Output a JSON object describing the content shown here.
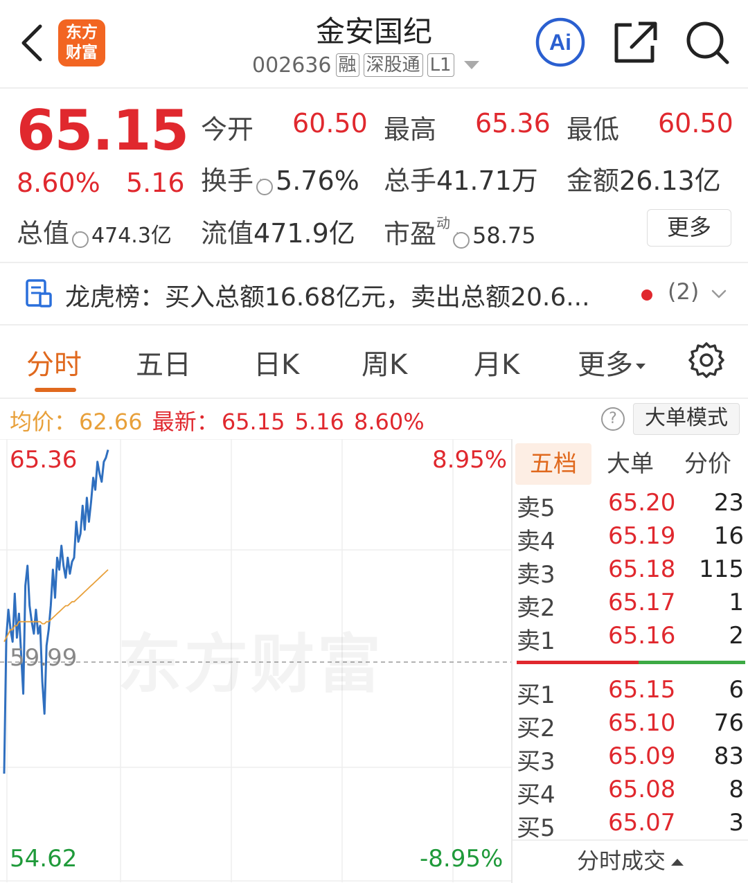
{
  "header": {
    "logo_line1": "东方",
    "logo_line2": "财富",
    "stock_name": "金安国纪",
    "stock_code": "002636",
    "tags": [
      "融",
      "深股通",
      "L1"
    ]
  },
  "quote": {
    "price": "65.15",
    "change_pct": "8.60%",
    "change_amt": "5.16",
    "open_label": "今开",
    "open": "60.50",
    "high_label": "最高",
    "high": "65.36",
    "low_label": "最低",
    "low": "60.50",
    "turnover_label": "换手",
    "turnover": "5.76%",
    "volume_label": "总手",
    "volume": "41.71万",
    "amount_label": "金额",
    "amount": "26.13亿",
    "mktcap_label": "总值",
    "mktcap": "474.3亿",
    "float_label": "流值",
    "float_cap": "471.9亿",
    "pe_label": "市盈",
    "pe_sup": "动",
    "pe": "58.75",
    "more_label": "更多"
  },
  "lhb": {
    "text": "龙虎榜：买入总额16.68亿元，卖出总额20.6...",
    "count": "(2)"
  },
  "tabs": {
    "fenshi": "分时",
    "wuri": "五日",
    "rik": "日K",
    "zhouk": "周K",
    "yuek": "月K",
    "more": "更多"
  },
  "avg_row": {
    "avg_label": "均价：",
    "avg_value": "62.66",
    "latest_label": "最新：",
    "latest_value": "65.15",
    "latest_change": "5.16",
    "latest_pct": "8.60%",
    "help": "?",
    "big_order_mode": "大单模式"
  },
  "chart_data": {
    "type": "line",
    "y_max_label": "65.36",
    "y_mid_label": "59.99",
    "y_min_label": "54.62",
    "pct_max_label": "8.95%",
    "pct_min_label": "-8.95%",
    "ylim": [
      54.62,
      65.36
    ],
    "prev_close": 59.99,
    "watermark": "东方财富",
    "series": [
      {
        "color": "#2f6fbf",
        "values": [
          57.2,
          60.6,
          61.3,
          60.8,
          60.5,
          61.7,
          60.6,
          61.2,
          60.2,
          59.2,
          61.9,
          62.4,
          61.4,
          61.0,
          60.7,
          61.3,
          60.7,
          60.9,
          59.5,
          58.7,
          60.4,
          60.8,
          61.4,
          62.3,
          61.6,
          62.6,
          62.3,
          62.9,
          62.4,
          62.1,
          62.6,
          62.2,
          62.5,
          62.6,
          63.5,
          63.0,
          63.2,
          63.9,
          63.3,
          64.1,
          63.5,
          64.0,
          64.6,
          64.3,
          65.0,
          64.7,
          64.5,
          65.0,
          65.1,
          65.3
        ]
      },
      {
        "color": "#e8a03a",
        "values": [
          60.5,
          60.6,
          60.7,
          60.8,
          60.8,
          60.9,
          60.9,
          61.0,
          61.0,
          61.0,
          61.0,
          61.0,
          61.0,
          61.0,
          61.0,
          61.0,
          61.0,
          61.0,
          60.95,
          60.95,
          61.0,
          61.0,
          61.05,
          61.1,
          61.15,
          61.2,
          61.25,
          61.3,
          61.35,
          61.4,
          61.4,
          61.45,
          61.5,
          61.5,
          61.55,
          61.6,
          61.65,
          61.7,
          61.75,
          61.8,
          61.85,
          61.9,
          61.95,
          62.0,
          62.05,
          62.1,
          62.15,
          62.2,
          62.25,
          62.3
        ]
      }
    ]
  },
  "order_book": {
    "tabs": [
      "五档",
      "大单",
      "分价"
    ],
    "asks": [
      {
        "label": "卖5",
        "price": "65.20",
        "vol": "23"
      },
      {
        "label": "卖4",
        "price": "65.19",
        "vol": "16"
      },
      {
        "label": "卖3",
        "price": "65.18",
        "vol": "115"
      },
      {
        "label": "卖2",
        "price": "65.17",
        "vol": "1"
      },
      {
        "label": "卖1",
        "price": "65.16",
        "vol": "2"
      }
    ],
    "bids": [
      {
        "label": "买1",
        "price": "65.15",
        "vol": "6"
      },
      {
        "label": "买2",
        "price": "65.10",
        "vol": "76"
      },
      {
        "label": "买3",
        "price": "65.09",
        "vol": "83"
      },
      {
        "label": "买4",
        "price": "65.08",
        "vol": "8"
      },
      {
        "label": "买5",
        "price": "65.07",
        "vol": "3"
      }
    ],
    "ticks_label": "分时成交"
  }
}
